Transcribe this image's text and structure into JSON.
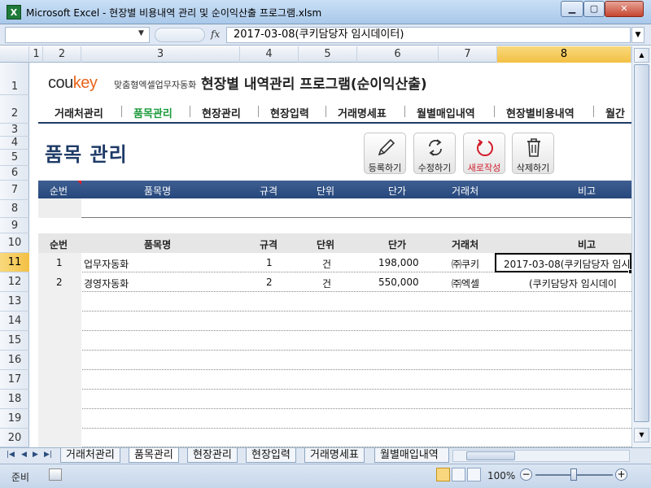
{
  "window": {
    "title": "Microsoft Excel - 현장별 비용내역 관리 및 순이익산출 프로그램.xlsm",
    "app_icon": "excel-icon"
  },
  "formula_bar": {
    "value": "2017-03-08(쿠키담당자 임시데이터)",
    "fx": "fx"
  },
  "columns": [
    "1",
    "2",
    "3",
    "4",
    "5",
    "6",
    "7",
    "8"
  ],
  "active_column": "8",
  "rows": [
    "1",
    "2",
    "3",
    "4",
    "5",
    "6",
    "7",
    "8",
    "9",
    "10",
    "11",
    "12",
    "13",
    "14",
    "15",
    "16",
    "17",
    "18",
    "19",
    "20"
  ],
  "active_row": "11",
  "logo": {
    "brand_prefix": "cou",
    "brand_suffix": "key",
    "subtitle": "맞춤형엑셀업무자동화"
  },
  "app_title": "현장별 내역관리 프로그램(순이익산출)",
  "nav": [
    {
      "label": "거래처관리",
      "current": false
    },
    {
      "label": "품목관리",
      "current": true
    },
    {
      "label": "현장관리",
      "current": false
    },
    {
      "label": "현장입력",
      "current": false
    },
    {
      "label": "거래명세표",
      "current": false
    },
    {
      "label": "월별매입내역",
      "current": false
    },
    {
      "label": "현장별비용내역",
      "current": false
    },
    {
      "label": "월간",
      "current": false
    }
  ],
  "page_title": "품목 관리",
  "actions": {
    "register": "등록하기",
    "edit": "수정하기",
    "new": "새로작성",
    "delete": "삭제하기"
  },
  "table": {
    "headers": [
      "순번",
      "품목명",
      "규격",
      "단위",
      "단가",
      "거래처",
      "비고"
    ],
    "rows": [
      {
        "no": "1",
        "name": "업무자동화",
        "spec": "1",
        "unit": "건",
        "price": "198,000",
        "vendor": "㈜쿠키",
        "note": "2017-03-08(쿠키담당자 임시"
      },
      {
        "no": "2",
        "name": "경영자동화",
        "spec": "2",
        "unit": "건",
        "price": "550,000",
        "vendor": "㈜엑셀",
        "note": "(쿠키담당자 임시데이"
      }
    ]
  },
  "sheet_tabs": [
    {
      "label": "거래처관리",
      "active": false
    },
    {
      "label": "품목관리",
      "active": true
    },
    {
      "label": "현장관리",
      "active": false
    },
    {
      "label": "현장입력",
      "active": false
    },
    {
      "label": "거래명세표",
      "active": false
    },
    {
      "label": "월별매입내역",
      "active": false
    }
  ],
  "status": {
    "text": "준비",
    "zoom": "100%",
    "zoom_fraction": 0.5
  }
}
